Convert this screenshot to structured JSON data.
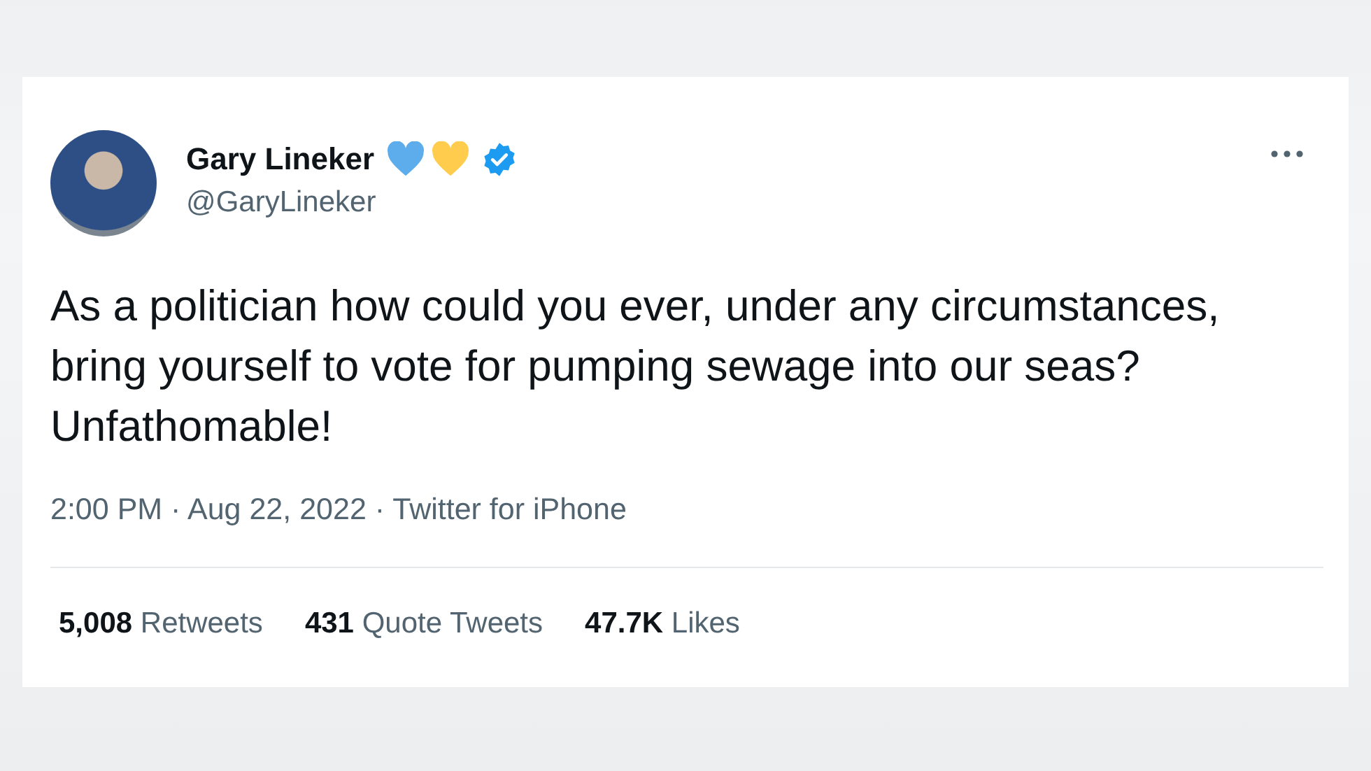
{
  "tweet": {
    "author": {
      "name": "Gary Lineker",
      "handle": "@GaryLineker",
      "verified": true
    },
    "text": "As a politician how could you ever, under any circumstances, bring yourself to vote for pumping sewage into our seas? Unfathomable!",
    "meta": "2:00 PM · Aug 22, 2022 · Twitter for iPhone",
    "stats": [
      {
        "count": "5,008",
        "label": "Retweets"
      },
      {
        "count": "431",
        "label": "Quote Tweets"
      },
      {
        "count": "47.7K",
        "label": "Likes"
      }
    ]
  }
}
